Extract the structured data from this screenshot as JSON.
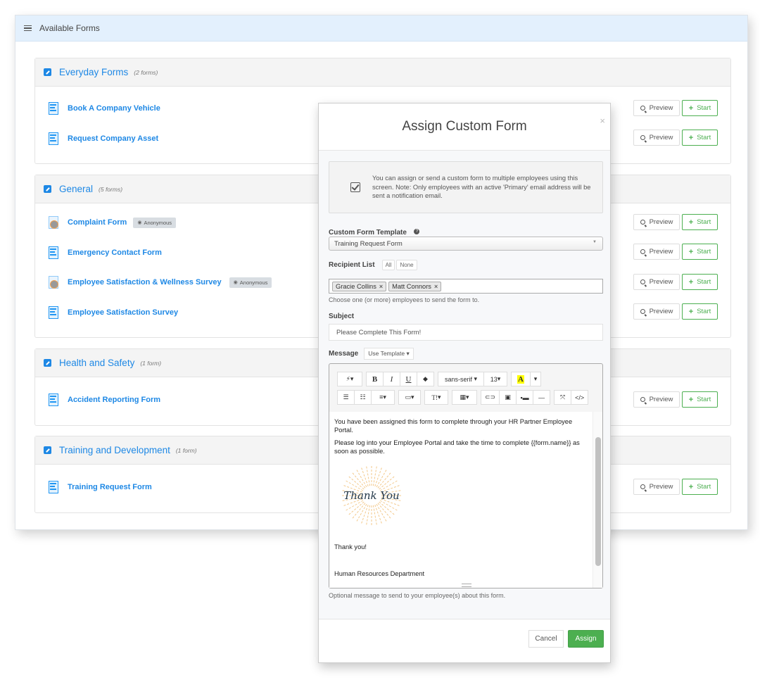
{
  "panel": {
    "title": "Available Forms",
    "groups": [
      {
        "title": "Everyday Forms",
        "count": "(2 forms)",
        "forms": [
          {
            "name": "Book A Company Vehicle",
            "anonymous": false
          },
          {
            "name": "Request Company Asset",
            "anonymous": false
          }
        ]
      },
      {
        "title": "General",
        "count": "(5 forms)",
        "forms": [
          {
            "name": "Complaint Form",
            "anonymous": true
          },
          {
            "name": "Emergency Contact Form",
            "anonymous": false
          },
          {
            "name": "Employee Satisfaction & Wellness Survey",
            "anonymous": true
          },
          {
            "name": "Employee Satisfaction Survey",
            "anonymous": false
          }
        ]
      },
      {
        "title": "Health and Safety",
        "count": "(1 form)",
        "forms": [
          {
            "name": "Accident Reporting Form",
            "anonymous": false
          }
        ]
      },
      {
        "title": "Training and Development",
        "count": "(1 form)",
        "forms": [
          {
            "name": "Training Request Form",
            "anonymous": false
          }
        ]
      }
    ],
    "anonymous_badge": "Anonymous",
    "preview_label": "Preview",
    "start_label": "Start"
  },
  "modal": {
    "title": "Assign Custom Form",
    "close_label": "×",
    "info_text": "You can assign or send a custom form to multiple employees using this screen. Note: Only employees with an active 'Primary' email address will be sent a notification email.",
    "template_label": "Custom Form Template",
    "template_value": "Training Request Form",
    "recipient_label": "Recipient List",
    "recipient_all": "All",
    "recipient_none": "None",
    "recipients": [
      "Gracie Collins",
      "Matt Connors"
    ],
    "recipient_help": "Choose one (or more) employees to send the form to.",
    "subject_label": "Subject",
    "subject_value": "Please Complete This Form!",
    "message_label": "Message",
    "use_template_label": "Use Template",
    "toolbar": {
      "font_family": "sans-serif",
      "font_size": "13",
      "highlight_letter": "A",
      "text_style_label": "T!"
    },
    "message_paragraphs": [
      "You have been assigned this form to complete through your HR Partner Employee Portal.",
      "Please log into your Employee Portal and take the time to complete {{form.name}} as soon as possible."
    ],
    "image_text": "Thank You",
    "sign_off": "Thank you!",
    "signature": "Human Resources Department",
    "message_help": "Optional message to send to your employee(s) about this form.",
    "cancel_label": "Cancel",
    "assign_label": "Assign"
  },
  "colors": {
    "accent": "#1e88e5",
    "success": "#4caf50",
    "header_bg": "#e3f0fd"
  }
}
